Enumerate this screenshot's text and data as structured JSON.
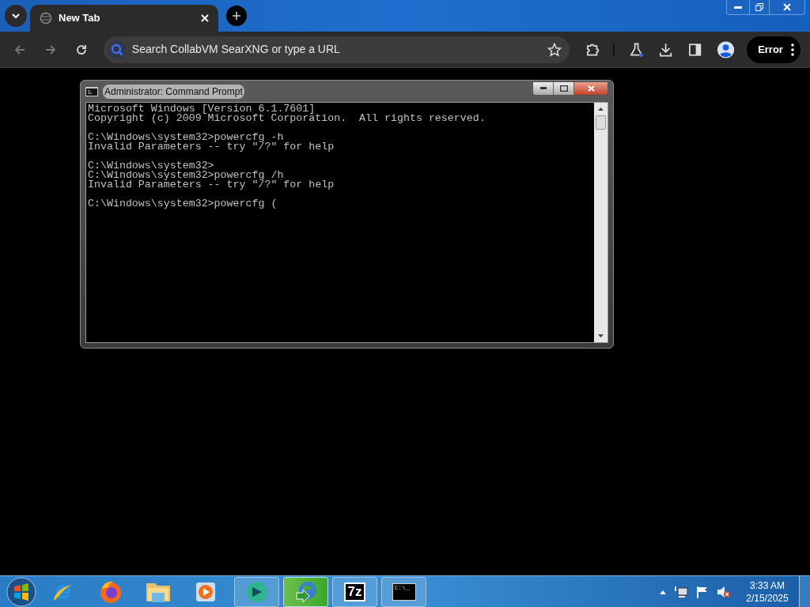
{
  "browser": {
    "tabs": [
      {
        "label": "New Tab",
        "selected": true
      }
    ],
    "address": {
      "placeholder": "Search CollabVM SearXNG or type a URL"
    },
    "profile_button": "Error"
  },
  "console": {
    "title": "Administrator: Command Prompt",
    "blocks": [
      [
        "Microsoft Windows [Version 6.1.7601]",
        "Copyright (c) 2009 Microsoft Corporation.  All rights reserved."
      ],
      [
        "C:\\Windows\\system32>powercfg -h",
        "Invalid Parameters -- try \"/?\" for help"
      ],
      [
        "C:\\Windows\\system32>",
        "C:\\Windows\\system32>powercfg /h",
        "Invalid Parameters -- try \"/?\" for help"
      ],
      [
        "C:\\Windows\\system32>powercfg ("
      ]
    ]
  },
  "taskbar": {
    "pinned": [
      {
        "kind": "ie"
      },
      {
        "kind": "firefox"
      },
      {
        "kind": "explorer"
      },
      {
        "kind": "media"
      }
    ],
    "windows": [
      {
        "kind": "disc",
        "selected": false
      },
      {
        "kind": "downloader",
        "selected": true
      },
      {
        "kind": "archiver",
        "label": "7z",
        "selected": false
      },
      {
        "kind": "console",
        "label": "C:\\_",
        "selected": false
      }
    ],
    "clock": {
      "time": "3:33 AM",
      "date": "2/15/2025"
    }
  }
}
